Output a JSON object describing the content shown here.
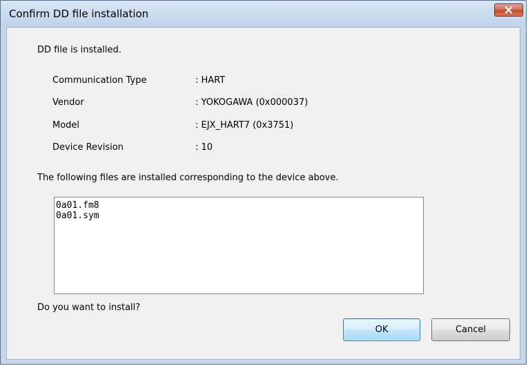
{
  "window": {
    "title": "Confirm DD file installation"
  },
  "dialog": {
    "status_message": "DD file is installed.",
    "info": [
      {
        "label": "Communication Type",
        "value": ": HART"
      },
      {
        "label": "Vendor",
        "value": ": YOKOGAWA (0x000037)"
      },
      {
        "label": "Model",
        "value": ": EJX_HART7 (0x3751)"
      },
      {
        "label": "Device Revision",
        "value": ": 10"
      }
    ],
    "files_message": "The following files are installed corresponding to the device above.",
    "files": [
      "0a01.fm8",
      "0a01.sym"
    ],
    "question": "Do you want to install?"
  },
  "buttons": {
    "ok_label": "OK",
    "cancel_label": "Cancel"
  },
  "colors": {
    "title_bar": "#c6d7ea",
    "client_bg": "#f0f0f0",
    "close_button": "#c44a2e",
    "ok_button_border": "#3c7fb1"
  },
  "icons": {
    "close": "close-icon"
  }
}
